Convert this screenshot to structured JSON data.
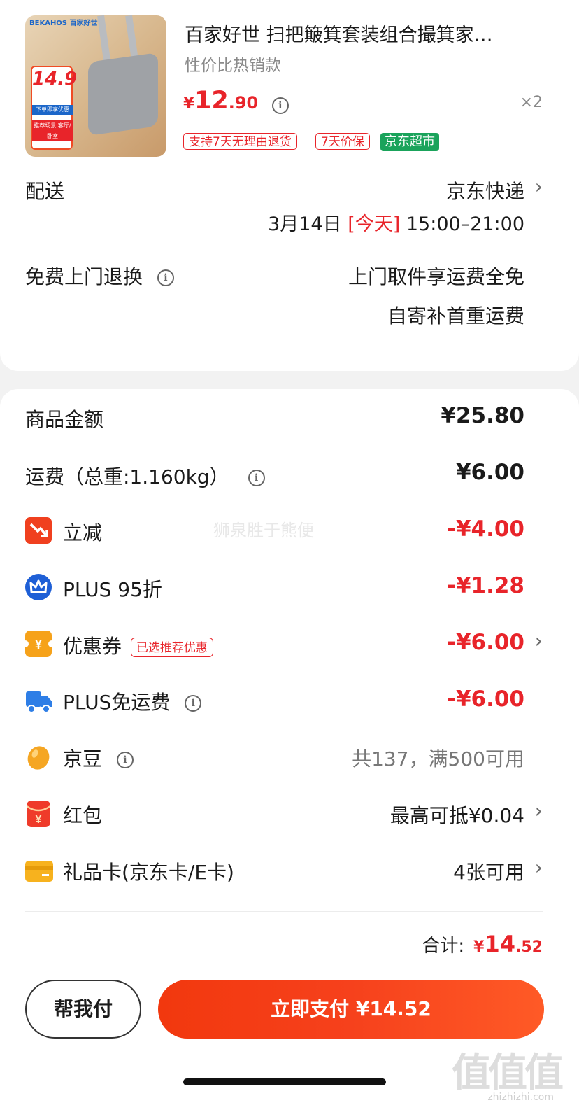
{
  "product": {
    "brand_text": "BEKAHOS 百家好世",
    "thumb_price": "14.9",
    "thumb_tag1": "下单即享优惠",
    "thumb_tag2": "推荐场景 客厅/卧室",
    "title": "百家好世 扫把簸箕套装组合撮箕家…",
    "subtitle": "性价比热销款",
    "price_symbol": "¥",
    "price_int": "12",
    "price_dec": ".90",
    "qty": "×2",
    "tags": [
      "支持7天无理由退货",
      "7天价保"
    ],
    "green_tag": "京东超市"
  },
  "delivery": {
    "label": "配送",
    "method": "京东快递",
    "date": "3月14日",
    "today": "[今天]",
    "window": "15:00–21:00"
  },
  "return_service": {
    "label": "免费上门退换",
    "line1": "上门取件享运费全免",
    "line2": "自寄补首重运费"
  },
  "summary": {
    "goods": {
      "label": "商品金额",
      "value": "¥25.80"
    },
    "shipping": {
      "label": "运费（总重:1.160kg）",
      "value": "¥6.00"
    },
    "instant": {
      "label": "立减",
      "value": "-¥4.00"
    },
    "plus95": {
      "label": "PLUS 95折",
      "value": "-¥1.28"
    },
    "coupon": {
      "label": "优惠券",
      "chip": "已选推荐优惠",
      "value": "-¥6.00"
    },
    "plus_ship": {
      "label": "PLUS免运费",
      "value": "-¥6.00"
    },
    "beans": {
      "label": "京豆",
      "value": "共137，满500可用"
    },
    "redpacket": {
      "label": "红包",
      "value": "最高可抵¥0.04"
    },
    "giftcard": {
      "label": "礼品卡(京东卡/E卡)",
      "value": "4张可用"
    },
    "total_label": "合计:",
    "total_symbol": "¥",
    "total_int": "14",
    "total_dec": ".52"
  },
  "footer": {
    "help_label": "帮我付",
    "pay_label": "立即支付 ¥14.52"
  },
  "watermarks": {
    "center": "狮泉胜于熊便",
    "logo": "值值值",
    "site": "zhizhizhi.com"
  },
  "colors": {
    "accent": "#e8242a",
    "green": "#1aa35b"
  },
  "icons": {
    "instant": "trend-down-icon",
    "plus95": "crown-icon",
    "coupon": "coupon-yen-icon",
    "plus_ship": "truck-icon",
    "beans": "bean-icon",
    "redpacket": "red-envelope-icon",
    "giftcard": "card-icon"
  }
}
